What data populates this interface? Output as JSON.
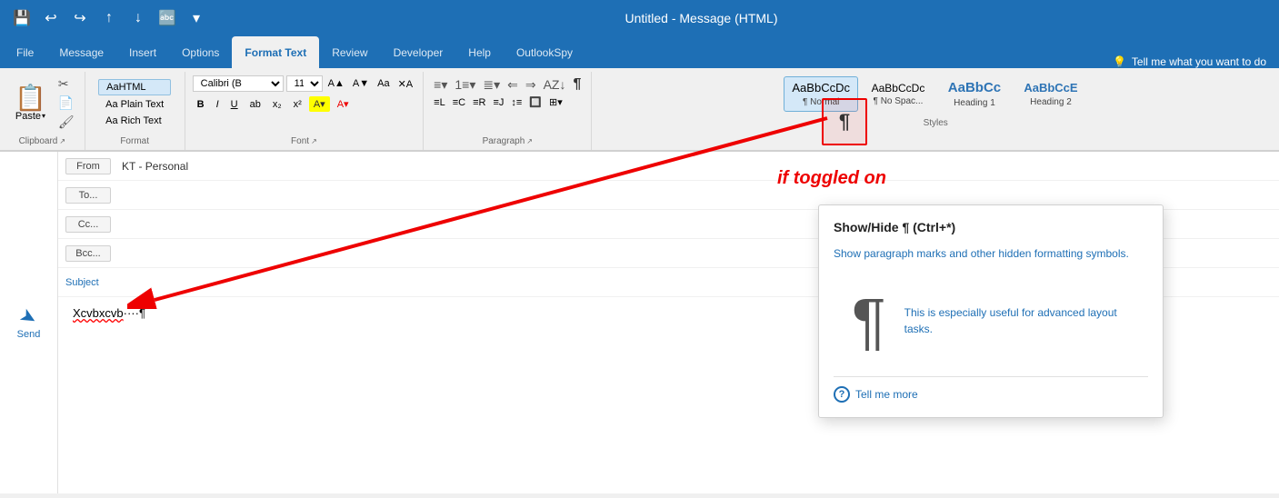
{
  "titleBar": {
    "title": "Untitled - Message (HTML)",
    "controls": [
      "save-icon",
      "undo-icon",
      "redo-icon",
      "up-icon",
      "down-icon",
      "translate-icon",
      "more-icon"
    ]
  },
  "ribbonTabs": {
    "tabs": [
      "File",
      "Message",
      "Insert",
      "Options",
      "Format Text",
      "Review",
      "Developer",
      "Help",
      "OutlookSpy"
    ],
    "activeTab": "Format Text",
    "tellMe": "Tell me what you want to do"
  },
  "clipboard": {
    "paste": "Paste",
    "label": "Clipboard"
  },
  "format": {
    "html": "AaHTML",
    "plainText": "Aa Plain Text",
    "richText": "Aa Rich Text",
    "label": "Format"
  },
  "font": {
    "family": "Calibri (B",
    "size": "11",
    "label": "Font",
    "boldLabel": "B",
    "italicLabel": "I",
    "underlineLabel": "U"
  },
  "paragraph": {
    "label": "Paragraph"
  },
  "styles": {
    "label": "Styles",
    "items": [
      {
        "preview": "AaBbCcDc",
        "label": "¶ Normal",
        "active": true
      },
      {
        "preview": "AaBbCcDc",
        "label": "¶ No Spac..."
      },
      {
        "preview": "AaBbCc",
        "label": "Heading 1"
      },
      {
        "preview": "AaBbCcE",
        "label": "Heading 2"
      }
    ]
  },
  "showHideBtn": {
    "symbol": "¶",
    "tooltip": {
      "title": "Show/Hide ¶ (Ctrl+*)",
      "desc1": "Show paragraph marks and other hidden formatting symbols.",
      "desc2": "This is especially useful for advanced layout tasks.",
      "tellMore": "Tell me more"
    }
  },
  "annotation": {
    "text": "if toggled on"
  },
  "email": {
    "fromLabel": "From",
    "fromValue": "KT - Personal",
    "toLabel": "To...",
    "ccLabel": "Cc...",
    "bccLabel": "Bcc...",
    "subjectLabel": "Subject",
    "sendLabel": "Send",
    "bodyText": "Xcvbxcvb····¶"
  }
}
